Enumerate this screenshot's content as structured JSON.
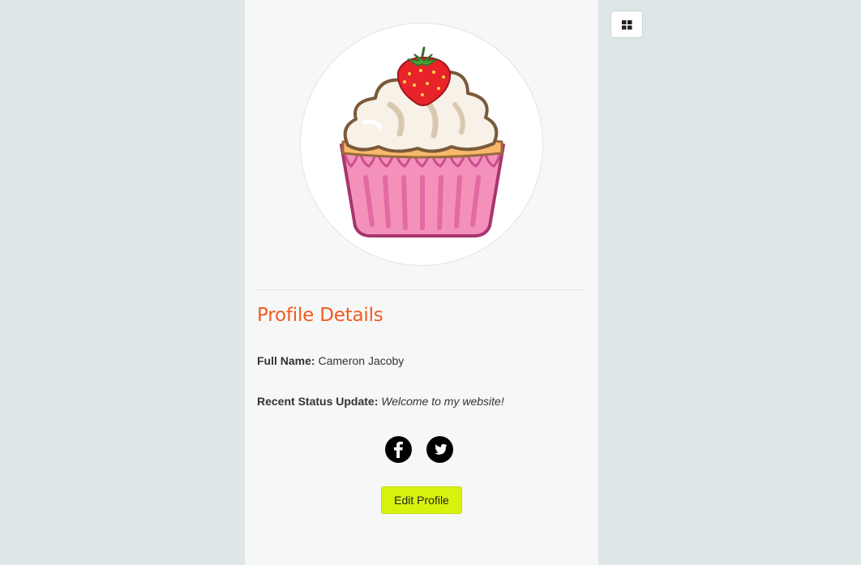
{
  "profile": {
    "avatar_icon": "cupcake-icon",
    "section_title": "Profile Details",
    "full_name_label": "Full Name:",
    "full_name_value": "Cameron Jacoby",
    "status_label": "Recent Status Update:",
    "status_value": "Welcome to my website!"
  },
  "social": {
    "facebook_icon": "facebook-icon",
    "twitter_icon": "twitter-icon"
  },
  "actions": {
    "edit_profile_label": "Edit Profile"
  },
  "toolbar": {
    "menu_icon": "grid-icon"
  },
  "colors": {
    "page_background": "#dfe6e8",
    "panel_background": "#f6f7f7",
    "title_accent": "#f05a1f",
    "button_accent": "#d6f20d"
  }
}
